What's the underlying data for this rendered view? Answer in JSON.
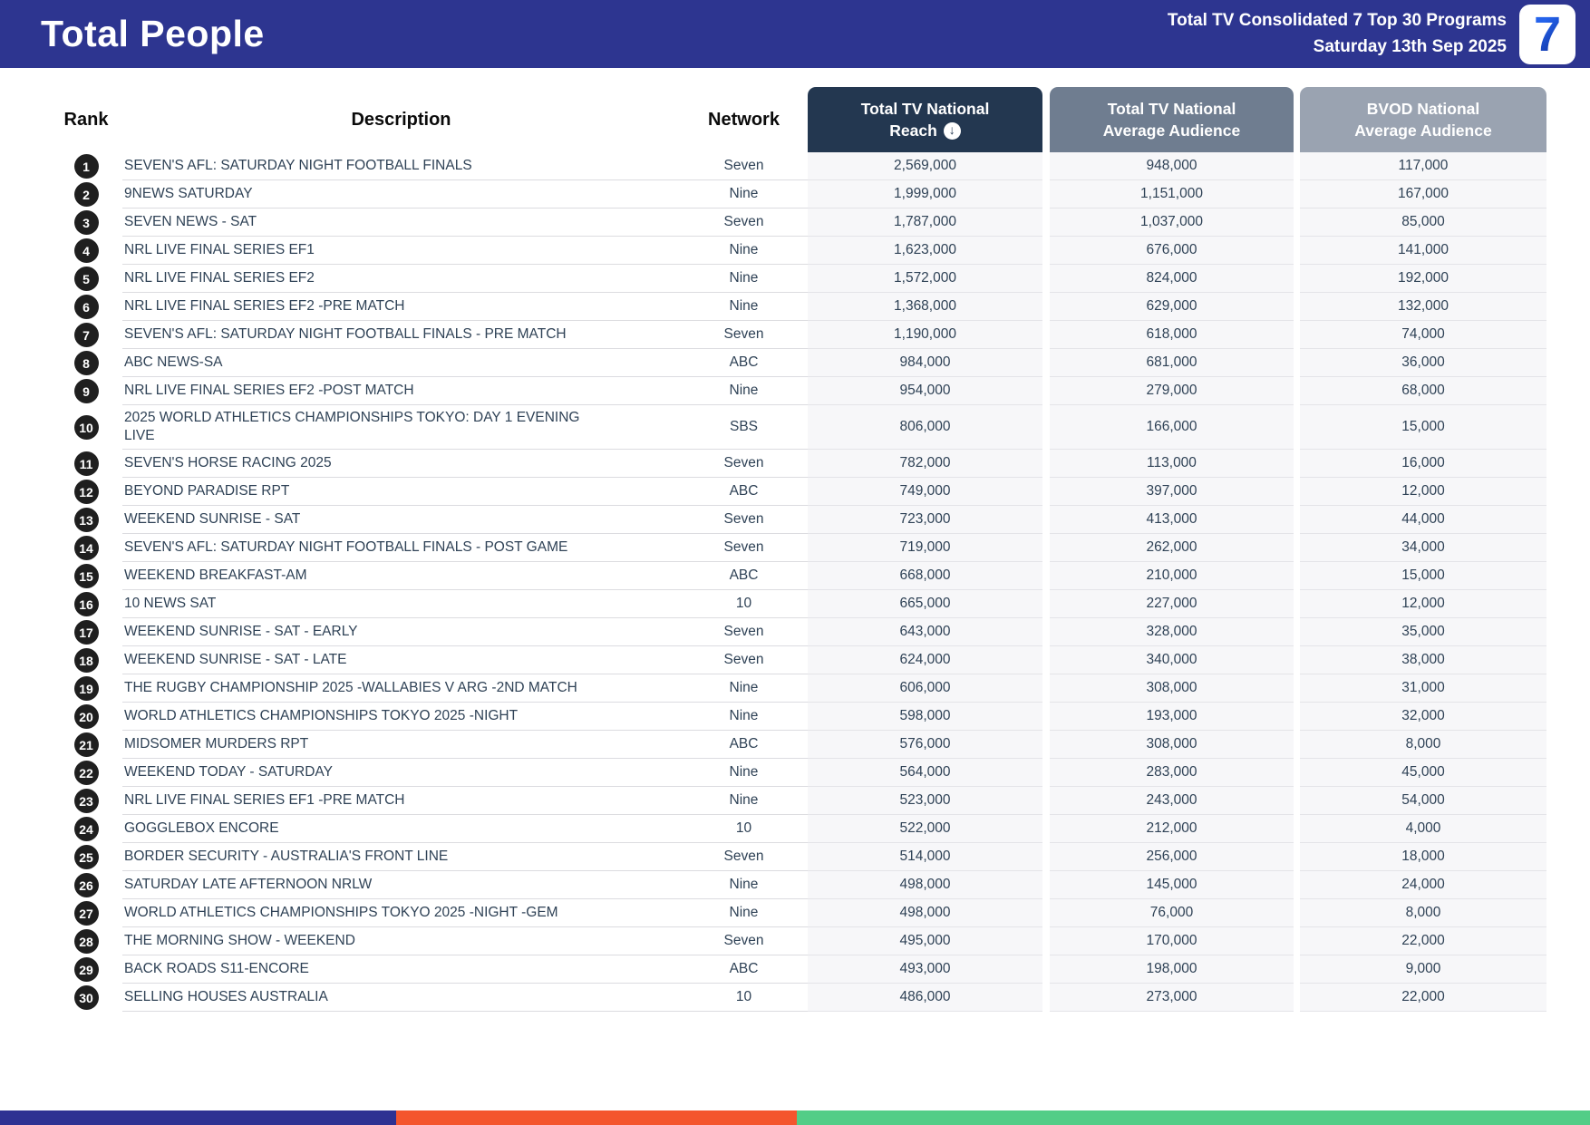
{
  "header": {
    "title": "Total People",
    "subtitle_line1": "Total TV Consolidated 7 Top 30 Programs",
    "subtitle_line2": "Saturday 13th Sep 2025",
    "logo_text": "7"
  },
  "colors": {
    "banner_blue": "#2D3590",
    "reach_box": "#233750",
    "avg_box": "#6F7D90",
    "bvod_box": "#9AA3B1",
    "footer_blue": "#2E3192",
    "footer_orange": "#F4552D",
    "footer_green": "#53CD87"
  },
  "table": {
    "columns": {
      "rank": "Rank",
      "description": "Description",
      "network": "Network",
      "reach_line1": "Total TV National",
      "reach_line2": "Reach",
      "avg_line1": "Total TV National",
      "avg_line2": "Average Audience",
      "bvod_line1": "BVOD National",
      "bvod_line2": "Average Audience"
    },
    "sort_indicator": "↓",
    "rows": [
      {
        "rank": "1",
        "description": "SEVEN'S AFL: SATURDAY NIGHT FOOTBALL FINALS",
        "network": "Seven",
        "reach": "2,569,000",
        "avg": "948,000",
        "bvod": "117,000"
      },
      {
        "rank": "2",
        "description": "9NEWS SATURDAY",
        "network": "Nine",
        "reach": "1,999,000",
        "avg": "1,151,000",
        "bvod": "167,000"
      },
      {
        "rank": "3",
        "description": "SEVEN NEWS - SAT",
        "network": "Seven",
        "reach": "1,787,000",
        "avg": "1,037,000",
        "bvod": "85,000"
      },
      {
        "rank": "4",
        "description": "NRL LIVE FINAL SERIES EF1",
        "network": "Nine",
        "reach": "1,623,000",
        "avg": "676,000",
        "bvod": "141,000"
      },
      {
        "rank": "5",
        "description": "NRL LIVE FINAL SERIES EF2",
        "network": "Nine",
        "reach": "1,572,000",
        "avg": "824,000",
        "bvod": "192,000"
      },
      {
        "rank": "6",
        "description": "NRL LIVE FINAL SERIES EF2 -PRE MATCH",
        "network": "Nine",
        "reach": "1,368,000",
        "avg": "629,000",
        "bvod": "132,000"
      },
      {
        "rank": "7",
        "description": "SEVEN'S AFL: SATURDAY NIGHT FOOTBALL FINALS - PRE MATCH",
        "network": "Seven",
        "reach": "1,190,000",
        "avg": "618,000",
        "bvod": "74,000"
      },
      {
        "rank": "8",
        "description": "ABC NEWS-SA",
        "network": "ABC",
        "reach": "984,000",
        "avg": "681,000",
        "bvod": "36,000"
      },
      {
        "rank": "9",
        "description": "NRL LIVE FINAL SERIES EF2 -POST MATCH",
        "network": "Nine",
        "reach": "954,000",
        "avg": "279,000",
        "bvod": "68,000"
      },
      {
        "rank": "10",
        "description": "2025 WORLD ATHLETICS CHAMPIONSHIPS TOKYO: DAY 1 EVENING LIVE",
        "network": "SBS",
        "reach": "806,000",
        "avg": "166,000",
        "bvod": "15,000"
      },
      {
        "rank": "11",
        "description": "SEVEN'S HORSE RACING 2025",
        "network": "Seven",
        "reach": "782,000",
        "avg": "113,000",
        "bvod": "16,000"
      },
      {
        "rank": "12",
        "description": "BEYOND PARADISE RPT",
        "network": "ABC",
        "reach": "749,000",
        "avg": "397,000",
        "bvod": "12,000"
      },
      {
        "rank": "13",
        "description": "WEEKEND SUNRISE - SAT",
        "network": "Seven",
        "reach": "723,000",
        "avg": "413,000",
        "bvod": "44,000"
      },
      {
        "rank": "14",
        "description": "SEVEN'S AFL: SATURDAY NIGHT FOOTBALL FINALS - POST GAME",
        "network": "Seven",
        "reach": "719,000",
        "avg": "262,000",
        "bvod": "34,000"
      },
      {
        "rank": "15",
        "description": "WEEKEND BREAKFAST-AM",
        "network": "ABC",
        "reach": "668,000",
        "avg": "210,000",
        "bvod": "15,000"
      },
      {
        "rank": "16",
        "description": "10 NEWS SAT",
        "network": "10",
        "reach": "665,000",
        "avg": "227,000",
        "bvod": "12,000"
      },
      {
        "rank": "17",
        "description": "WEEKEND SUNRISE - SAT - EARLY",
        "network": "Seven",
        "reach": "643,000",
        "avg": "328,000",
        "bvod": "35,000"
      },
      {
        "rank": "18",
        "description": "WEEKEND SUNRISE - SAT - LATE",
        "network": "Seven",
        "reach": "624,000",
        "avg": "340,000",
        "bvod": "38,000"
      },
      {
        "rank": "19",
        "description": "THE RUGBY CHAMPIONSHIP 2025 -WALLABIES V ARG -2ND MATCH",
        "network": "Nine",
        "reach": "606,000",
        "avg": "308,000",
        "bvod": "31,000"
      },
      {
        "rank": "20",
        "description": "WORLD ATHLETICS CHAMPIONSHIPS TOKYO 2025 -NIGHT",
        "network": "Nine",
        "reach": "598,000",
        "avg": "193,000",
        "bvod": "32,000"
      },
      {
        "rank": "21",
        "description": "MIDSOMER MURDERS RPT",
        "network": "ABC",
        "reach": "576,000",
        "avg": "308,000",
        "bvod": "8,000"
      },
      {
        "rank": "22",
        "description": "WEEKEND TODAY - SATURDAY",
        "network": "Nine",
        "reach": "564,000",
        "avg": "283,000",
        "bvod": "45,000"
      },
      {
        "rank": "23",
        "description": "NRL LIVE FINAL SERIES EF1 -PRE MATCH",
        "network": "Nine",
        "reach": "523,000",
        "avg": "243,000",
        "bvod": "54,000"
      },
      {
        "rank": "24",
        "description": "GOGGLEBOX ENCORE",
        "network": "10",
        "reach": "522,000",
        "avg": "212,000",
        "bvod": "4,000"
      },
      {
        "rank": "25",
        "description": "BORDER SECURITY - AUSTRALIA'S FRONT LINE",
        "network": "Seven",
        "reach": "514,000",
        "avg": "256,000",
        "bvod": "18,000"
      },
      {
        "rank": "26",
        "description": "SATURDAY LATE AFTERNOON NRLW",
        "network": "Nine",
        "reach": "498,000",
        "avg": "145,000",
        "bvod": "24,000"
      },
      {
        "rank": "27",
        "description": "WORLD ATHLETICS CHAMPIONSHIPS TOKYO 2025 -NIGHT -GEM",
        "network": "Nine",
        "reach": "498,000",
        "avg": "76,000",
        "bvod": "8,000"
      },
      {
        "rank": "28",
        "description": "THE MORNING SHOW - WEEKEND",
        "network": "Seven",
        "reach": "495,000",
        "avg": "170,000",
        "bvod": "22,000"
      },
      {
        "rank": "29",
        "description": "BACK ROADS S11-ENCORE",
        "network": "ABC",
        "reach": "493,000",
        "avg": "198,000",
        "bvod": "9,000"
      },
      {
        "rank": "30",
        "description": "SELLING HOUSES AUSTRALIA",
        "network": "10",
        "reach": "486,000",
        "avg": "273,000",
        "bvod": "22,000"
      }
    ]
  },
  "footer": {
    "segments": [
      {
        "name": "blue",
        "width_pct": 24.9
      },
      {
        "name": "orange",
        "width_pct": 25.2
      },
      {
        "name": "green",
        "width_pct": 49.9
      }
    ]
  }
}
